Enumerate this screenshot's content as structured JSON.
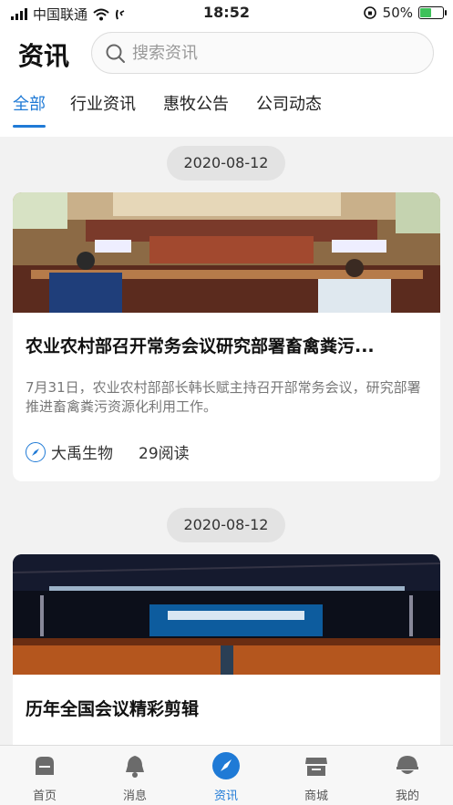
{
  "status_bar": {
    "carrier": "中国联通",
    "time": "18:52",
    "battery": "50%"
  },
  "header": {
    "title": "资讯",
    "search_placeholder": "搜索资讯"
  },
  "tabs": [
    {
      "label": "全部",
      "active": true
    },
    {
      "label": "行业资讯",
      "active": false
    },
    {
      "label": "惠牧公告",
      "active": false
    },
    {
      "label": "公司动态",
      "active": false
    }
  ],
  "feed": [
    {
      "date": "2020-08-12",
      "title": "农业农村部召开常务会议研究部署畜禽粪污...",
      "description": "7月31日，农业农村部部长韩长赋主持召开部常务会议，研究部署推进畜禽粪污资源化利用工作。",
      "source": "大禹生物",
      "reads": "29阅读"
    },
    {
      "date": "2020-08-12",
      "title": "历年全国会议精彩剪辑"
    }
  ],
  "bottom_nav": [
    {
      "label": "首页",
      "icon": "home-icon",
      "active": false
    },
    {
      "label": "消息",
      "icon": "bell-icon",
      "active": false
    },
    {
      "label": "资讯",
      "icon": "compass-icon",
      "active": true
    },
    {
      "label": "商城",
      "icon": "store-icon",
      "active": false
    },
    {
      "label": "我的",
      "icon": "profile-icon",
      "active": false
    }
  ],
  "colors": {
    "accent": "#1f7ad6",
    "background": "#f2f2f2"
  }
}
